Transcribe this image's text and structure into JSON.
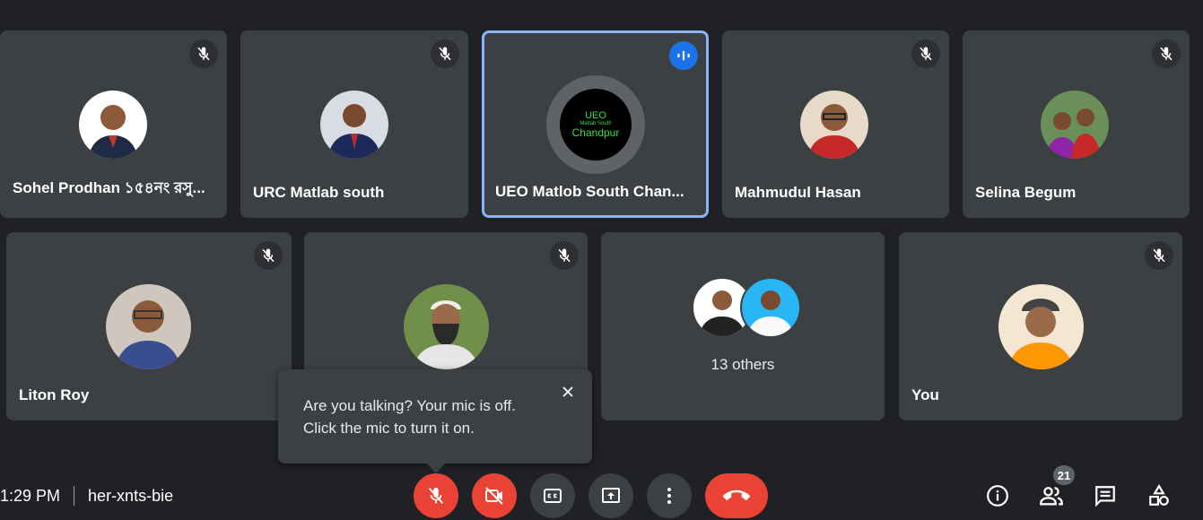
{
  "tiles_row1": [
    {
      "name": "Sohel Prodhan ১৫৪নং রসু..."
    },
    {
      "name": "URC Matlab south"
    },
    {
      "name": "UEO Matlob South Chan..."
    },
    {
      "name": "Mahmudul Hasan"
    },
    {
      "name": "Selina Begum"
    }
  ],
  "tiles_row2": [
    {
      "name": "Liton Roy"
    },
    {
      "name": ""
    },
    {
      "others": "13 others"
    },
    {
      "name": "You"
    }
  ],
  "ueo_avatar": {
    "line1": "UEO",
    "line2": "Matlab South",
    "line3": "Chandpur"
  },
  "tooltip": {
    "line1": "Are you talking? Your mic is off.",
    "line2": "Click the mic to turn it on."
  },
  "meeting": {
    "time": "1:29 PM",
    "code": "her-xnts-bie"
  },
  "participants_count": "21",
  "icons": [
    "mic-off-icon",
    "speaking-icon",
    "close-icon",
    "videocam-off-icon",
    "captions-icon",
    "present-icon",
    "more-icon",
    "hangup-icon",
    "info-icon",
    "people-icon",
    "chat-icon",
    "activities-icon"
  ],
  "colors": {
    "background": "#202124",
    "tile": "#3c4043",
    "accent": "#8ab4f8",
    "red": "#ea4335",
    "speaking": "#1a73e8"
  }
}
